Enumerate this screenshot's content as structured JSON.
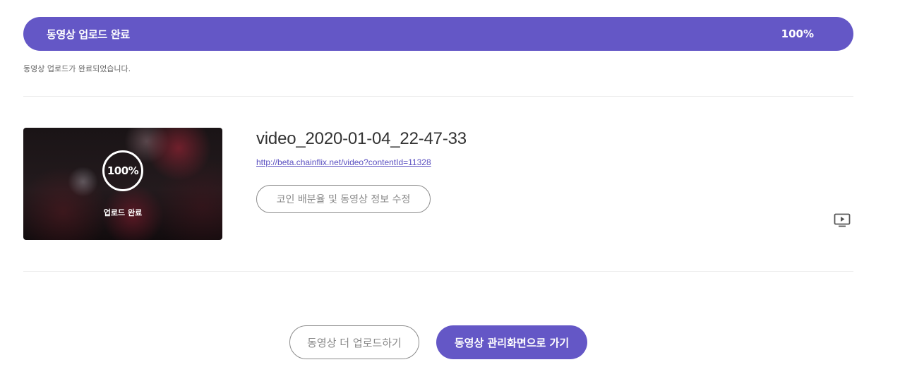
{
  "progress": {
    "title": "동영상 업로드 완료",
    "percent": "100%",
    "value": 1.0,
    "status_message": "동영상 업로드가 완료되었습니다."
  },
  "video": {
    "thumbnail_percent": "100%",
    "thumbnail_label": "업로드 완료",
    "title": "video_2020-01-04_22-47-33",
    "link": "http://beta.chainflix.net/video?contentId=11328",
    "edit_button_label": "코인 배분율 및 동영상 정보 수정",
    "player_icon": "video-player-icon"
  },
  "actions": {
    "upload_more_label": "동영상 더 업로드하기",
    "go_manage_label": "동영상 관리화면으로 가기"
  },
  "colors": {
    "accent": "#6457c6",
    "link": "#5a4fc0"
  }
}
